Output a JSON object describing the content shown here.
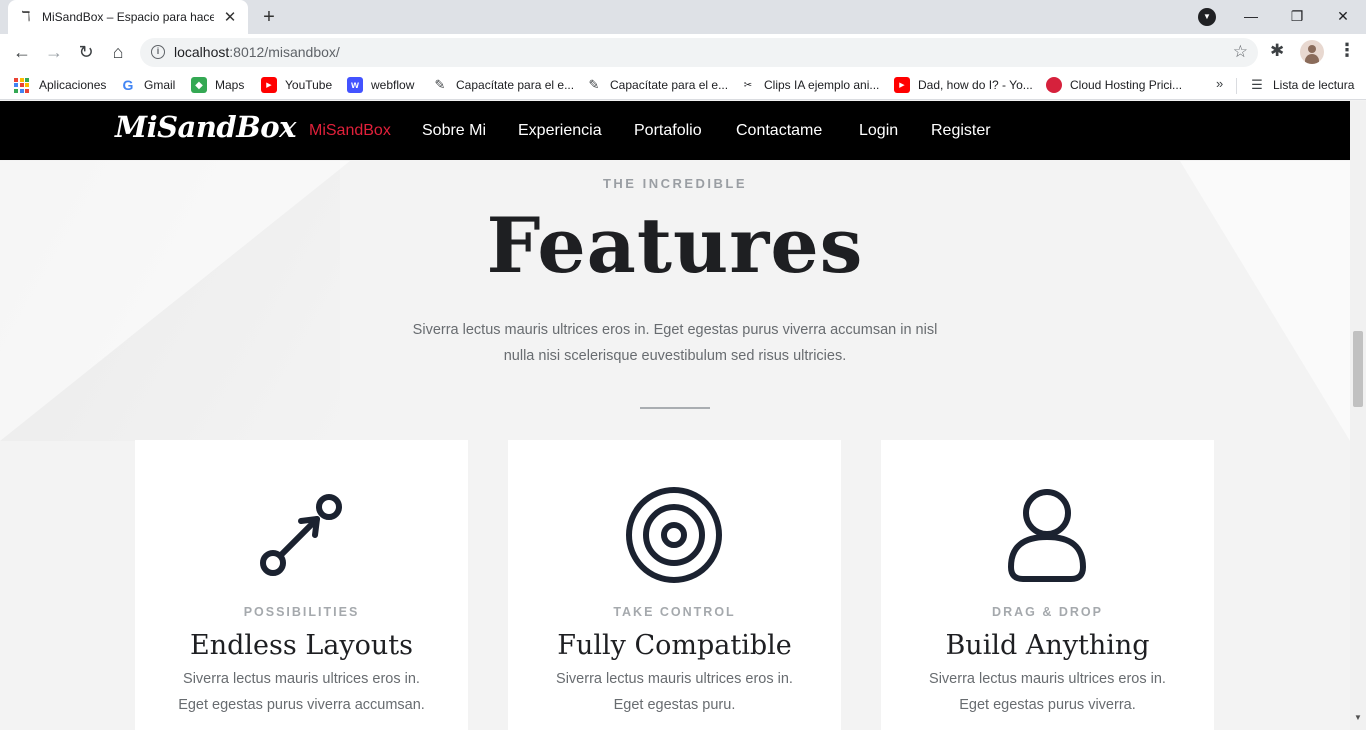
{
  "browser": {
    "tab_title": "MiSandBox – Espacio para hacer",
    "tab_favicon": "ℸ",
    "url_host": "localhost",
    "url_path": ":8012/misandbox/",
    "bookmarks": [
      {
        "label": "Aplicaciones",
        "icon": "apps-icon"
      },
      {
        "label": "Gmail",
        "icon": "google-icon"
      },
      {
        "label": "Maps",
        "icon": "maps-icon"
      },
      {
        "label": "YouTube",
        "icon": "youtube-icon"
      },
      {
        "label": "webflow",
        "icon": "webflow-icon"
      },
      {
        "label": "Capacítate para el e...",
        "icon": "edit-doc-icon"
      },
      {
        "label": "Capacítate para el e...",
        "icon": "edit-doc-icon"
      },
      {
        "label": "Clips IA ejemplo ani...",
        "icon": "clips-icon"
      },
      {
        "label": "Dad, how do I? - Yo...",
        "icon": "youtube-icon"
      },
      {
        "label": "Cloud Hosting Prici...",
        "icon": "cloud-hosting-icon"
      }
    ],
    "more_bookmarks": "»",
    "reading_list": "Lista de lectura"
  },
  "site": {
    "logo": "MiSandBox",
    "nav": [
      {
        "label": "MiSandBox",
        "active": true
      },
      {
        "label": "Sobre Mi"
      },
      {
        "label": "Experiencia"
      },
      {
        "label": "Portafolio"
      },
      {
        "label": "Contactame"
      },
      {
        "label": "Login"
      },
      {
        "label": "Register"
      }
    ]
  },
  "features": {
    "eyebrow": "THE INCREDIBLE",
    "title": "Features",
    "text_line1": "Siverra lectus mauris ultrices eros in. Eget egestas purus viverra accumsan in nisl",
    "text_line2": "nulla nisi scelerisque euvestibulum sed risus ultricies."
  },
  "cards": [
    {
      "icon": "connect-nodes-icon",
      "eyebrow": "POSSIBILITIES",
      "title": "Endless Layouts",
      "line1": "Siverra lectus mauris ultrices eros in.",
      "line2": "Eget egestas purus viverra accumsan."
    },
    {
      "icon": "target-icon",
      "eyebrow": "TAKE CONTROL",
      "title": "Fully Compatible",
      "line1": "Siverra lectus mauris ultrices eros in.",
      "line2": "Eget egestas puru."
    },
    {
      "icon": "user-icon",
      "eyebrow": "DRAG & DROP",
      "title": "Build Anything",
      "line1": "Siverra lectus mauris ultrices eros in.",
      "line2": "Eget egestas purus viverra."
    }
  ],
  "colors": {
    "accent": "#e0203a",
    "nav_bg": "#000000",
    "icon_dark": "#1b2230"
  }
}
